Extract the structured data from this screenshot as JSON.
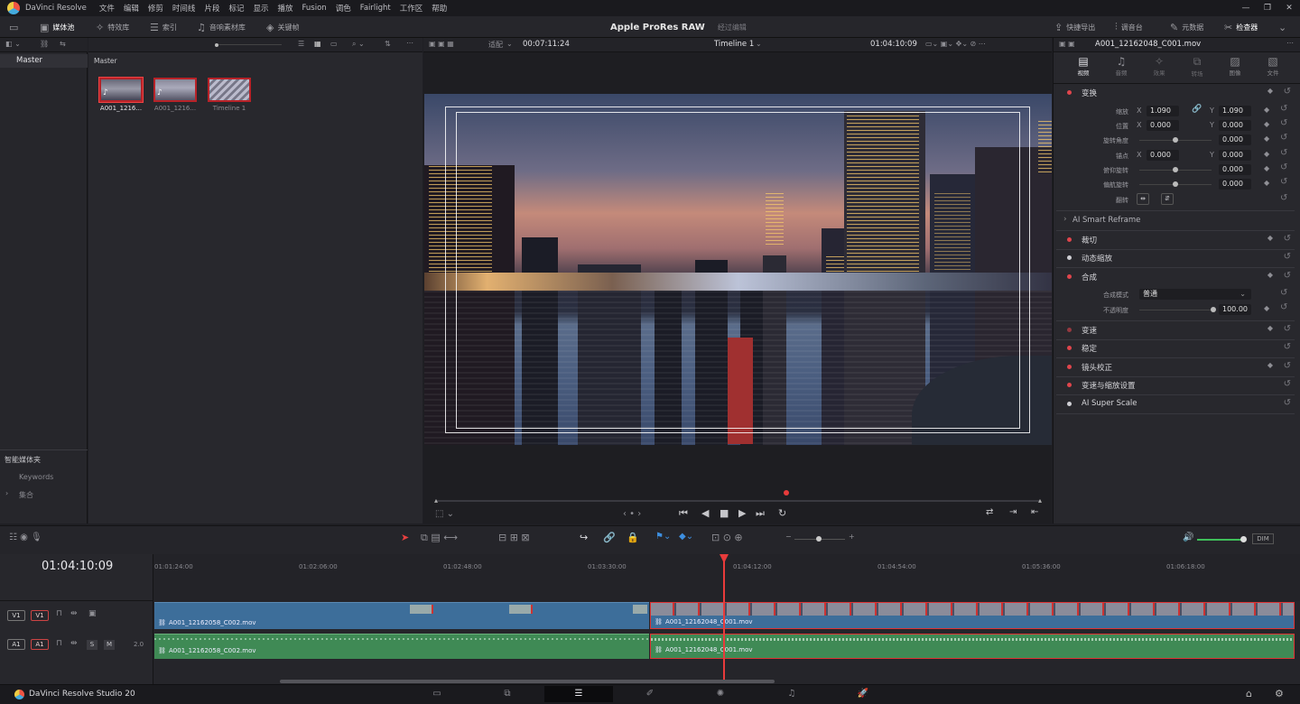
{
  "menu": {
    "app_name": "DaVinci Resolve",
    "items": [
      "文件",
      "编辑",
      "修剪",
      "时间线",
      "片段",
      "标记",
      "显示",
      "播放",
      "Fusion",
      "调色",
      "Fairlight",
      "工作区",
      "帮助"
    ]
  },
  "toolbar": {
    "left": [
      {
        "label": "媒体池",
        "icon": "media-pool-icon"
      },
      {
        "label": "特效库",
        "icon": "effects-icon"
      },
      {
        "label": "索引",
        "icon": "index-icon"
      },
      {
        "label": "音响素材库",
        "icon": "sound-library-icon"
      },
      {
        "label": "关键帧",
        "icon": "keyframe-icon"
      }
    ],
    "project_title": "Apple ProRes RAW",
    "project_status": "经过编辑",
    "right": [
      {
        "label": "快捷导出",
        "icon": "export-icon"
      },
      {
        "label": "调音台",
        "icon": "mixer-icon"
      },
      {
        "label": "元数据",
        "icon": "metadata-icon"
      },
      {
        "label": "检查器",
        "icon": "inspector-icon"
      }
    ]
  },
  "media_pool": {
    "root": "Master",
    "folder": "Master",
    "smart_bins_title": "智能媒体夹",
    "smart_bins": [
      "Keywords",
      "集合"
    ],
    "clips": [
      {
        "name": "A001_1216..."
      },
      {
        "name": "A001_1216..."
      },
      {
        "name": "Timeline 1"
      }
    ]
  },
  "viewer": {
    "fit": "适配",
    "source_tc": "00:07:11:24",
    "timeline_name": "Timeline 1",
    "record_tc": "01:04:10:09"
  },
  "inspector": {
    "clip_name": "A001_12162048_C001.mov",
    "tabs": [
      "视频",
      "音频",
      "效果",
      "转场",
      "图像",
      "文件"
    ],
    "sections": [
      {
        "label": "变换",
        "enabled": true
      },
      {
        "label": "AI Smart Reframe",
        "enabled": false
      },
      {
        "label": "裁切",
        "enabled": true
      },
      {
        "label": "动态缩放",
        "enabled": false
      },
      {
        "label": "合成",
        "enabled": true
      },
      {
        "label": "变速",
        "enabled": true
      },
      {
        "label": "稳定",
        "enabled": true
      },
      {
        "label": "镜头校正",
        "enabled": true
      },
      {
        "label": "变速与缩放设置",
        "enabled": true
      },
      {
        "label": "AI Super Scale",
        "enabled": false
      }
    ],
    "transform": {
      "zoom_label": "缩放",
      "zoom_x": "1.090",
      "zoom_y": "1.090",
      "position_label": "位置",
      "pos_x": "0.000",
      "pos_y": "0.000",
      "rotation_label": "旋转角度",
      "rotation": "0.000",
      "anchor_label": "锚点",
      "anchor_x": "0.000",
      "anchor_y": "0.000",
      "pitch_label": "俯仰旋转",
      "pitch": "0.000",
      "yaw_label": "偏航旋转",
      "yaw": "0.000",
      "flip_label": "翻转",
      "x": "X",
      "y": "Y"
    },
    "composite": {
      "mode_label": "合成模式",
      "mode": "普通",
      "opacity_label": "不透明度",
      "opacity": "100.00"
    }
  },
  "timeline": {
    "timecode": "01:04:10:09",
    "ruler": [
      "01:01:24:00",
      "01:02:06:00",
      "01:02:48:00",
      "01:03:30:00",
      "01:04:12:00",
      "01:04:54:00",
      "01:05:36:00",
      "01:06:18:00"
    ],
    "video_track": {
      "src": "V1",
      "dst": "V1"
    },
    "audio_track": {
      "src": "A1",
      "dst": "A1",
      "s": "S",
      "m": "M",
      "ch": "2.0"
    },
    "clips": {
      "v1a": "A001_12162058_C002.mov",
      "v1b": "A001_12162048_C001.mov",
      "a1a": "A001_12162058_C002.mov",
      "a1b": "A001_12162048_C001.mov"
    },
    "dim": "DIM"
  },
  "statusbar": {
    "product": "DaVinci Resolve Studio 20",
    "pages": [
      "media-icon",
      "cut-icon",
      "edit-icon",
      "fusion-icon",
      "color-icon",
      "fairlight-icon",
      "deliver-icon"
    ]
  },
  "colors": {
    "accent": "#e0454c",
    "video_clip": "#3d6e9a",
    "audio_clip": "#3f8a55",
    "playhead": "#e83b3b"
  }
}
